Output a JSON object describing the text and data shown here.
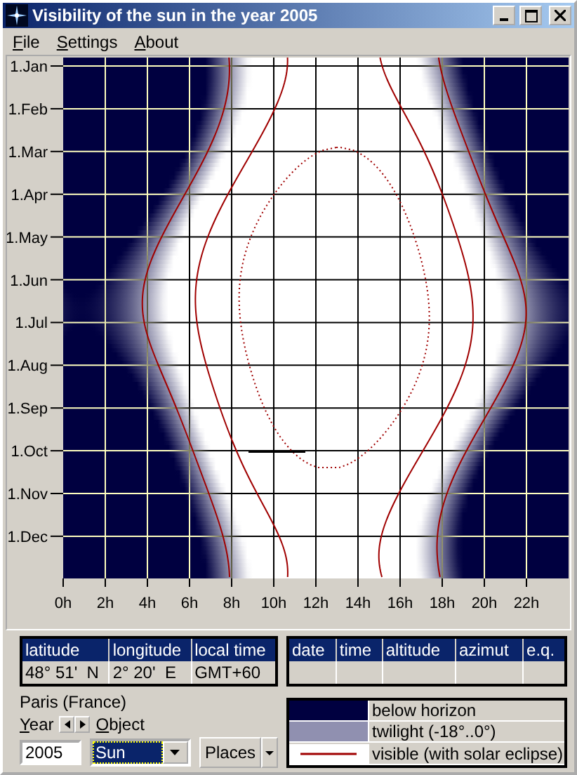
{
  "window": {
    "title": "Visibility of the sun in the year 2005"
  },
  "menu": [
    {
      "label": "File"
    },
    {
      "label": "Settings"
    },
    {
      "label": "About"
    }
  ],
  "chart": {
    "y_labels": [
      "1.Jan",
      "1.Feb",
      "1.Mar",
      "1.Apr",
      "1.May",
      "1.Jun",
      "1.Jul",
      "1.Aug",
      "1.Sep",
      "1.Oct",
      "1.Nov",
      "1.Dec"
    ],
    "x_labels": [
      "0h",
      "2h",
      "4h",
      "6h",
      "8h",
      "10h",
      "12h",
      "14h",
      "16h",
      "18h",
      "20h",
      "22h"
    ]
  },
  "location_table": {
    "columns": [
      "latitude",
      "longitude",
      "local time"
    ],
    "row": [
      "48° 51'  N",
      "2° 20'  E",
      "GMT+60"
    ]
  },
  "event_table": {
    "columns": [
      "date",
      "time",
      "altitude",
      "azimut",
      "e.q."
    ]
  },
  "place": "Paris (France)",
  "year": {
    "label": "Year",
    "value": "2005"
  },
  "object": {
    "label": "Object",
    "value": "Sun"
  },
  "places_button": {
    "label": "Places"
  },
  "legend": [
    {
      "kind": "night",
      "label": "below horizon"
    },
    {
      "kind": "twilight",
      "label": "twilight (-18°..0°)"
    },
    {
      "kind": "line",
      "label": "visible (with solar eclipse)"
    }
  ]
}
